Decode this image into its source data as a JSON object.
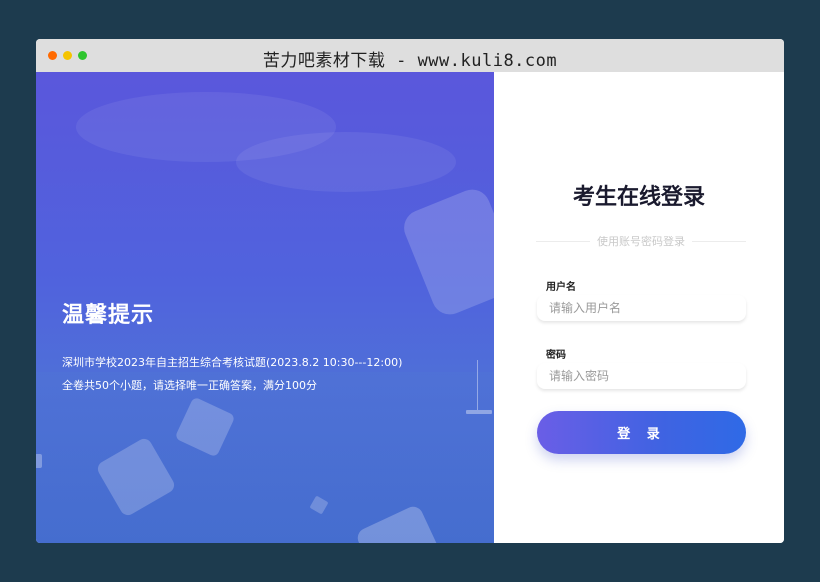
{
  "window": {
    "title": "苦力吧素材下载 - www.kuli8.com"
  },
  "notice": {
    "title": "温馨提示",
    "line1": "深圳市学校2023年自主招生综合考核试题(2023.8.2 10:30---12:00)",
    "line2": "全卷共50个小题，请选择唯一正确答案，满分100分"
  },
  "login": {
    "title": "考生在线登录",
    "divider_text": "使用账号密码登录",
    "username_label": "用户名",
    "username_placeholder": "请输入用户名",
    "password_label": "密码",
    "password_placeholder": "请输入密码",
    "submit_label": "登 录"
  },
  "colors": {
    "page_background": "#1d3b4e",
    "accent_start": "#6a5ee6",
    "accent_end": "#2f6ae6",
    "panel_left": "#5a57dc"
  },
  "icons": [
    "close-dot",
    "minimize-dot",
    "maximize-dot"
  ]
}
